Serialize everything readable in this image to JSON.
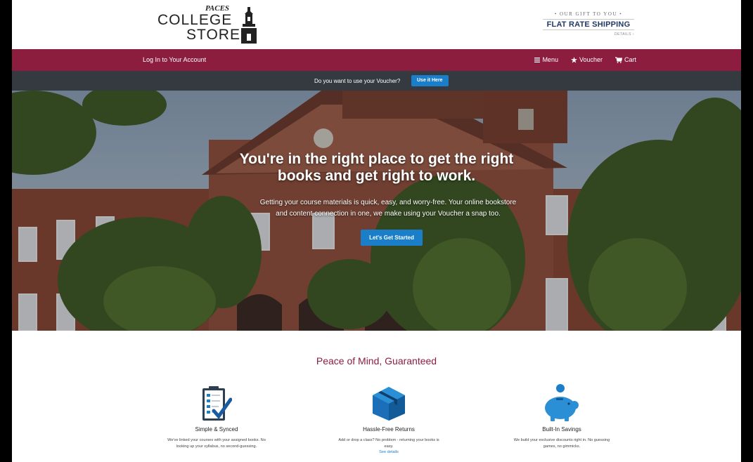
{
  "header": {
    "logo": {
      "top": "PACES",
      "line1": "COLLEGE",
      "line2": "STORE"
    },
    "gift": {
      "small": "• OUR GIFT TO YOU •",
      "big": "FLAT RATE SHIPPING",
      "details": "DETAILS ›"
    }
  },
  "nav": {
    "login": "Log In to Your Account",
    "menu": "Menu",
    "voucher": "Voucher",
    "cart": "Cart"
  },
  "voucher_bar": {
    "question": "Do you want to use your Voucher?",
    "button": "Use it Here"
  },
  "hero": {
    "headline_1": "You're in the right place to get the right",
    "headline_2": "books and get right to work.",
    "body_1": "Getting your course materials is quick, easy, and worry-free. Your online bookstore",
    "body_2": "and content connection in one, we make using your Voucher a snap too.",
    "cta": "Let's Get Started"
  },
  "features": {
    "heading": "Peace of Mind, Guaranteed",
    "items": [
      {
        "icon": "clipboard-check-icon",
        "title": "Simple & Synced",
        "desc": "We've linked your courses with your assigned books. No looking up your syllabus, no second-guessing.",
        "link": ""
      },
      {
        "icon": "box-icon",
        "title": "Hassle-Free Returns",
        "desc": "Add or drop a class? No problem - returning your books is easy.",
        "link": "See details"
      },
      {
        "icon": "piggy-bank-icon",
        "title": "Built-In Savings",
        "desc": "We build your exclusive discounts right in. No guessing games, no gimmicks.",
        "link": ""
      }
    ]
  },
  "colors": {
    "brand": "#8c1d3f",
    "accent": "#1a7ec8",
    "voucher_bar": "#353a40"
  }
}
